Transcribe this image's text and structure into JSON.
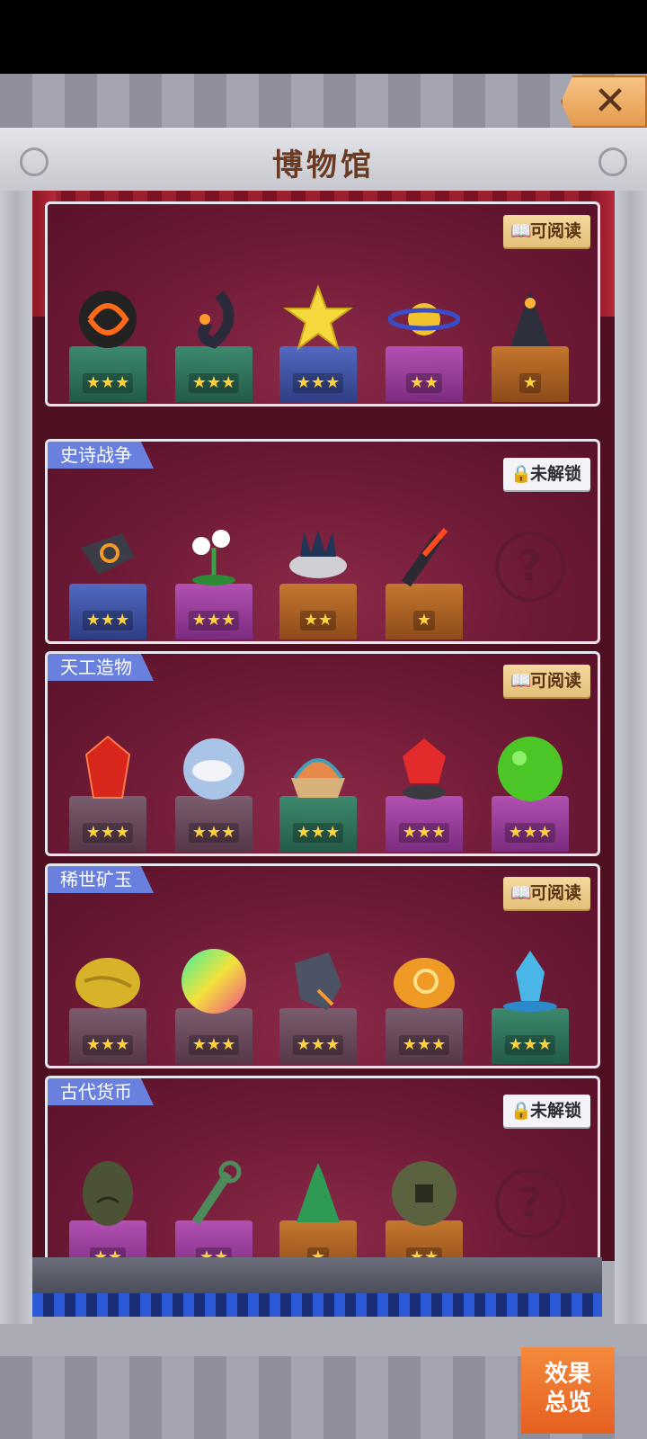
{
  "title": "博物馆",
  "close_label": "✕",
  "effect_button_label": "效果\n总览",
  "sections": [
    {
      "label": "",
      "badge": "可阅读",
      "badge_state": "readable",
      "items": [
        {
          "name": "lava-orb",
          "stars": 3,
          "pedestal": "green"
        },
        {
          "name": "black-serpent",
          "stars": 3,
          "pedestal": "green"
        },
        {
          "name": "golden-star",
          "stars": 3,
          "pedestal": "blue"
        },
        {
          "name": "ringed-planet",
          "stars": 2,
          "pedestal": "purple"
        },
        {
          "name": "dark-cloaked-figure",
          "stars": 1,
          "pedestal": "orange"
        }
      ]
    },
    {
      "label": "史诗战争",
      "badge": "未解锁",
      "badge_state": "locked",
      "items": [
        {
          "name": "spiral-shield",
          "stars": 3,
          "pedestal": "blue"
        },
        {
          "name": "lily-flower",
          "stars": 3,
          "pedestal": "purple"
        },
        {
          "name": "dragon-skull",
          "stars": 2,
          "pedestal": "orange"
        },
        {
          "name": "flaming-sword",
          "stars": 1,
          "pedestal": "orange"
        },
        {
          "name": "unknown",
          "stars": 0,
          "pedestal": "none"
        }
      ]
    },
    {
      "label": "天工造物",
      "badge": "可阅读",
      "badge_state": "readable",
      "items": [
        {
          "name": "red-crystal",
          "stars": 3,
          "pedestal": "grey"
        },
        {
          "name": "cloud-sphere",
          "stars": 3,
          "pedestal": "grey"
        },
        {
          "name": "layered-sand-box",
          "stars": 3,
          "pedestal": "green"
        },
        {
          "name": "red-gem-ore",
          "stars": 3,
          "pedestal": "purple"
        },
        {
          "name": "green-jade-orb",
          "stars": 3,
          "pedestal": "purple"
        }
      ]
    },
    {
      "label": "稀世矿玉",
      "badge": "可阅读",
      "badge_state": "readable",
      "items": [
        {
          "name": "gold-ore",
          "stars": 3,
          "pedestal": "grey"
        },
        {
          "name": "rainbow-orb",
          "stars": 3,
          "pedestal": "grey"
        },
        {
          "name": "black-rock",
          "stars": 3,
          "pedestal": "grey"
        },
        {
          "name": "amber-stone",
          "stars": 3,
          "pedestal": "grey"
        },
        {
          "name": "ice-crystal",
          "stars": 3,
          "pedestal": "green"
        }
      ]
    },
    {
      "label": "古代货币",
      "badge": "未解锁",
      "badge_state": "locked",
      "items": [
        {
          "name": "shell-coin",
          "stars": 2,
          "pedestal": "purple"
        },
        {
          "name": "key-knife-coin",
          "stars": 2,
          "pedestal": "purple"
        },
        {
          "name": "spade-coin",
          "stars": 1,
          "pedestal": "orange"
        },
        {
          "name": "round-coin",
          "stars": 2,
          "pedestal": "orange"
        },
        {
          "name": "unknown",
          "stars": 0,
          "pedestal": "none"
        }
      ]
    }
  ]
}
